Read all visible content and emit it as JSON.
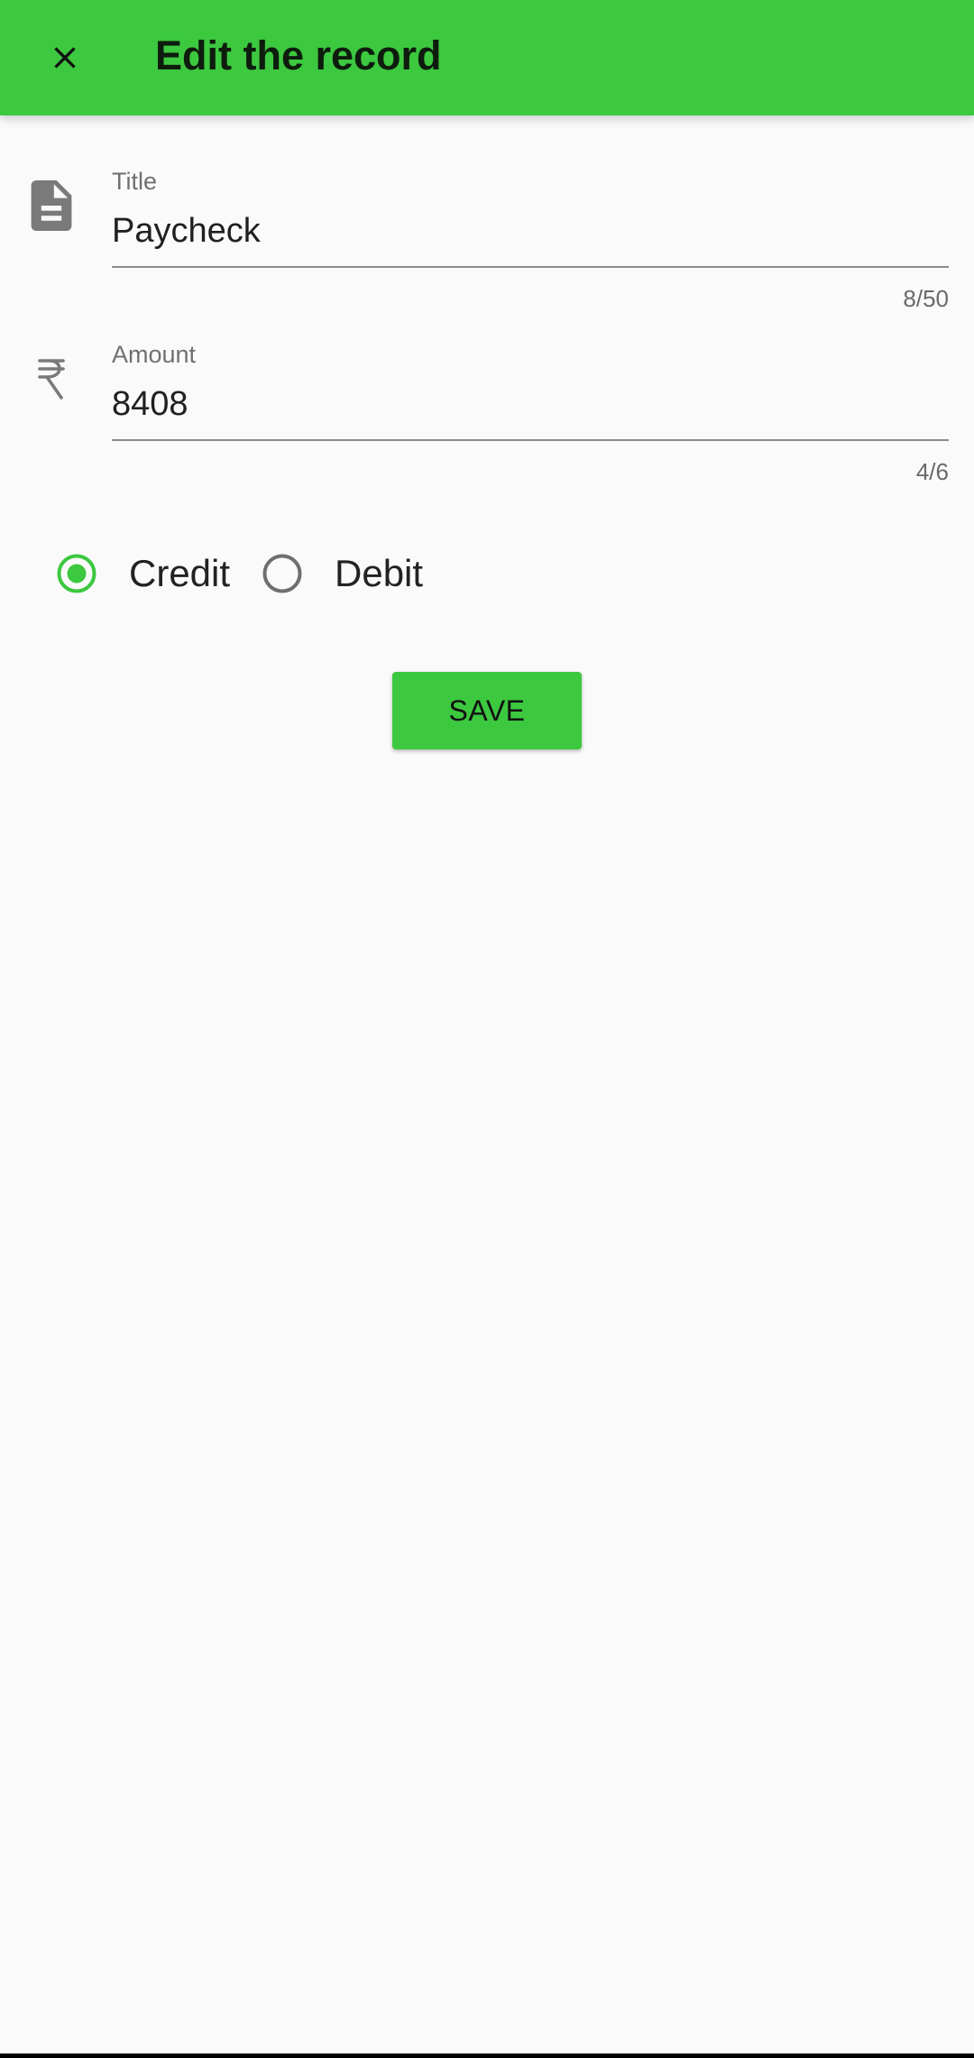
{
  "appbar": {
    "title": "Edit the record",
    "close_icon": "close-icon"
  },
  "colors": {
    "accent": "#3cc83f",
    "background": "#fafafa",
    "icon_gray": "#7a7a7a"
  },
  "form": {
    "title_field": {
      "icon": "document-icon",
      "label": "Title",
      "value": "Paycheck",
      "counter": "8/50"
    },
    "amount_field": {
      "icon": "rupee-icon",
      "label": "Amount",
      "value": "8408",
      "counter": "4/6"
    },
    "type_options": [
      {
        "label": "Credit",
        "selected": true
      },
      {
        "label": "Debit",
        "selected": false
      }
    ],
    "save_label": "SAVE"
  }
}
